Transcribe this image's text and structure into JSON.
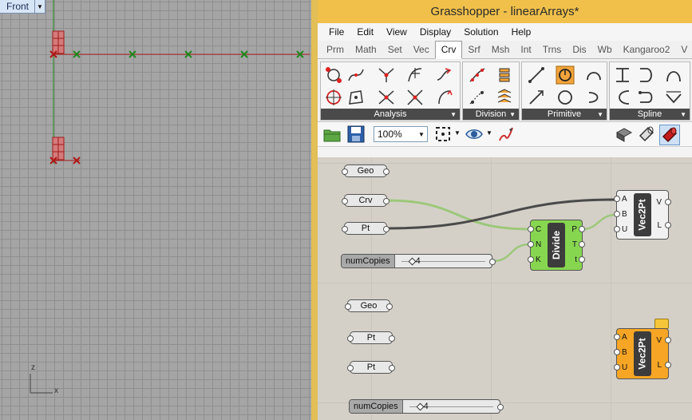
{
  "viewport": {
    "name": "Front",
    "axis_x": "x",
    "axis_z": "z"
  },
  "grasshopper": {
    "title": "Grasshopper - linearArrays*",
    "menu": [
      "File",
      "Edit",
      "View",
      "Display",
      "Solution",
      "Help"
    ],
    "tabs": [
      "Prm",
      "Math",
      "Set",
      "Vec",
      "Crv",
      "Srf",
      "Msh",
      "Int",
      "Trns",
      "Dis",
      "Wb",
      "Kangaroo2",
      "V"
    ],
    "active_tab": "Crv",
    "panels": [
      "Analysis",
      "Division",
      "Primitive",
      "Spline"
    ],
    "zoom": "100%"
  },
  "canvas": {
    "params_top": {
      "geo": "Geo",
      "crv": "Crv",
      "pt": "Pt"
    },
    "slider_top": {
      "name": "numCopies",
      "value": "4"
    },
    "divide": {
      "name": "Divide",
      "inputs": [
        "C",
        "N",
        "K"
      ],
      "outputs": [
        "P",
        "T",
        "t"
      ]
    },
    "vec2pt_top": {
      "name": "Vec2Pt",
      "inputs": [
        "A",
        "B",
        "U"
      ],
      "outputs": [
        "V",
        "L"
      ]
    },
    "params_bottom": {
      "geo": "Geo",
      "pt1": "Pt",
      "pt2": "Pt"
    },
    "slider_bottom": {
      "name": "numCopies",
      "value": "4"
    },
    "vec2pt_bottom": {
      "name": "Vec2Pt",
      "inputs": [
        "A",
        "B",
        "U"
      ],
      "outputs": [
        "V",
        "L"
      ]
    }
  },
  "colors": {
    "title_bar": "#f0c04a",
    "divide_component": "#87d650",
    "orange_component": "#f6a524",
    "viewport_bg": "#a5a5a5",
    "curve_red": "#b02020",
    "point_green": "#1c8a1c"
  }
}
